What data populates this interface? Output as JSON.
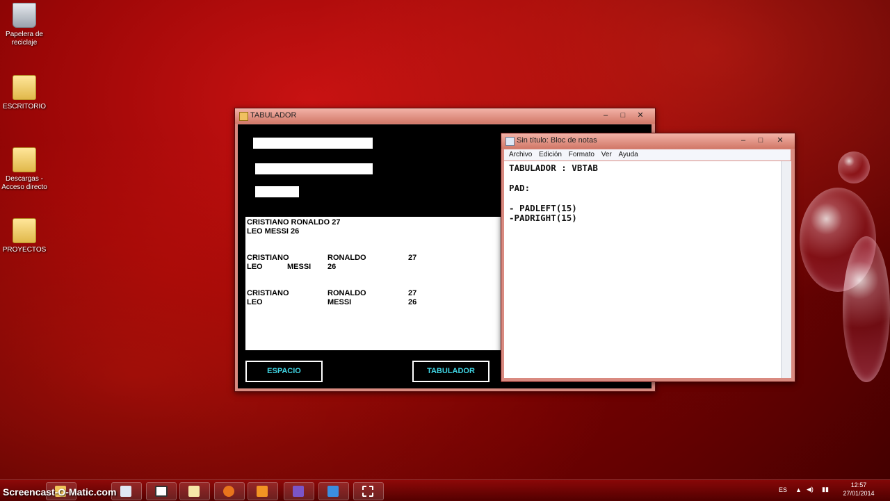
{
  "desktop": {
    "icons": [
      {
        "label": "Papelera de reciclaje",
        "icon": "recycle-bin-icon"
      },
      {
        "label": "ESCRITORIO",
        "icon": "folder-icon"
      },
      {
        "label": "Descargas - Acceso directo",
        "icon": "folder-shortcut-icon"
      },
      {
        "label": "PROYECTOS",
        "icon": "folder-icon"
      }
    ]
  },
  "tabulador_window": {
    "title": "TABULADOR",
    "output_lines": [
      "CRISTIANO RONALDO 27",
      "LEO MESSI 26"
    ],
    "space_rows": [
      [
        "CRISTIANO",
        "RONALDO",
        "27"
      ],
      [
        "LEO",
        "MESSI",
        "26"
      ]
    ],
    "tab_rows": [
      [
        "CRISTIANO",
        "RONALDO",
        "27"
      ],
      [
        "LEO",
        "MESSI",
        "26"
      ]
    ],
    "buttons": {
      "espacio": "ESPACIO",
      "tabulador": "TABULADOR"
    },
    "accent": "#41d7e6"
  },
  "notepad_window": {
    "title": "Sin título: Bloc de notas",
    "menu": [
      "Archivo",
      "Edición",
      "Formato",
      "Ver",
      "Ayuda"
    ],
    "lines": [
      "TABULADOR : VBTAB",
      "PAD:",
      "- PADLEFT(15)",
      "-PADRIGHT(15)"
    ]
  },
  "taskbar": {
    "watermark": "Screencast-O-Matic.com",
    "language": "ES",
    "time": "12:57",
    "date": "27/01/2014"
  }
}
